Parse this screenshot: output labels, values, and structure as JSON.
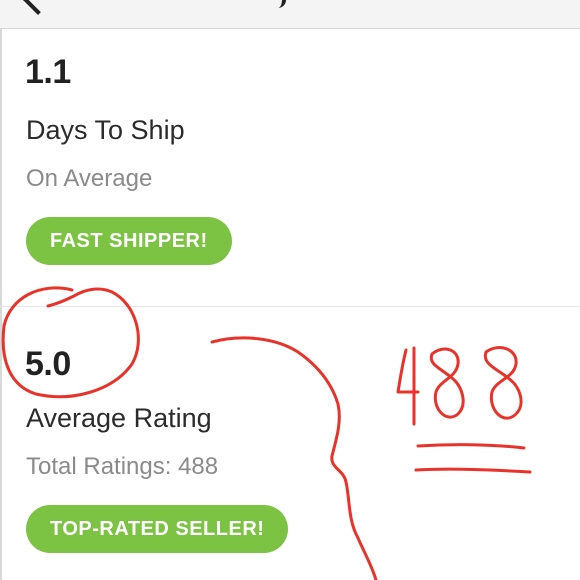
{
  "header": {
    "back_icon": "chevron-left-icon"
  },
  "shipping": {
    "value": "1.1",
    "label": "Days To Ship",
    "sublabel": "On Average",
    "badge": "FAST SHIPPER!"
  },
  "rating": {
    "value": "5.0",
    "label": "Average Rating",
    "sublabel": "Total Ratings: 488",
    "badge": "TOP-RATED SELLER!"
  },
  "annotation": {
    "handwritten_text": "488",
    "color": "#e8332a"
  },
  "colors": {
    "badge": "#7cc243",
    "muted_text": "#8a8a8a"
  }
}
